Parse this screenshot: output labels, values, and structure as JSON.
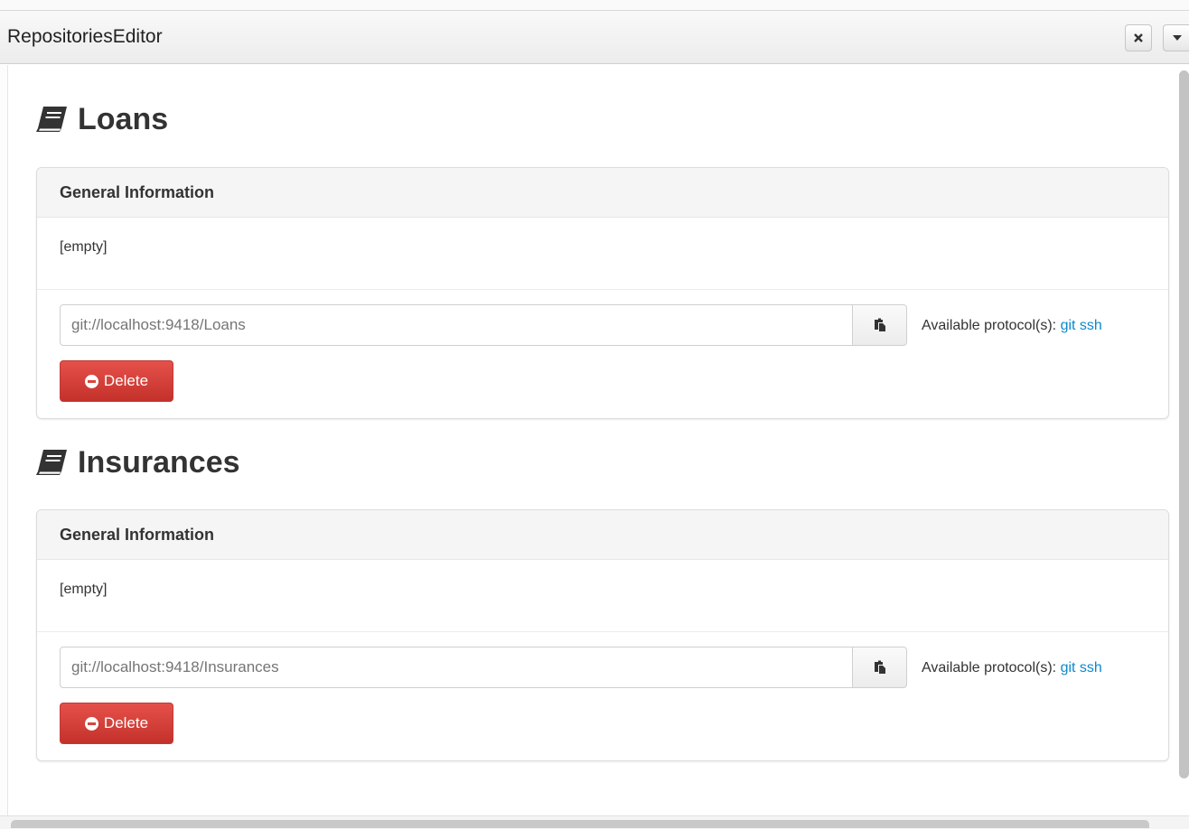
{
  "window": {
    "title": "RepositoriesEditor"
  },
  "repositories": [
    {
      "name": "Loans",
      "panel_title": "General Information",
      "description": "[empty]",
      "url_placeholder": "git://localhost:9418/Loans",
      "protocols_label": "Available protocol(s):",
      "protocols": [
        "git",
        "ssh"
      ],
      "delete_label": "Delete"
    },
    {
      "name": "Insurances",
      "panel_title": "General Information",
      "description": "[empty]",
      "url_placeholder": "git://localhost:9418/Insurances",
      "protocols_label": "Available protocol(s):",
      "protocols": [
        "git",
        "ssh"
      ],
      "delete_label": "Delete"
    }
  ],
  "icons": {
    "heading": "book-icon",
    "copy": "clipboard-icon",
    "delete": "minus-circle-icon",
    "close": "close-icon",
    "menu": "caret-down-icon"
  },
  "colors": {
    "delete": "#d9443d",
    "link": "#0b88cc"
  }
}
